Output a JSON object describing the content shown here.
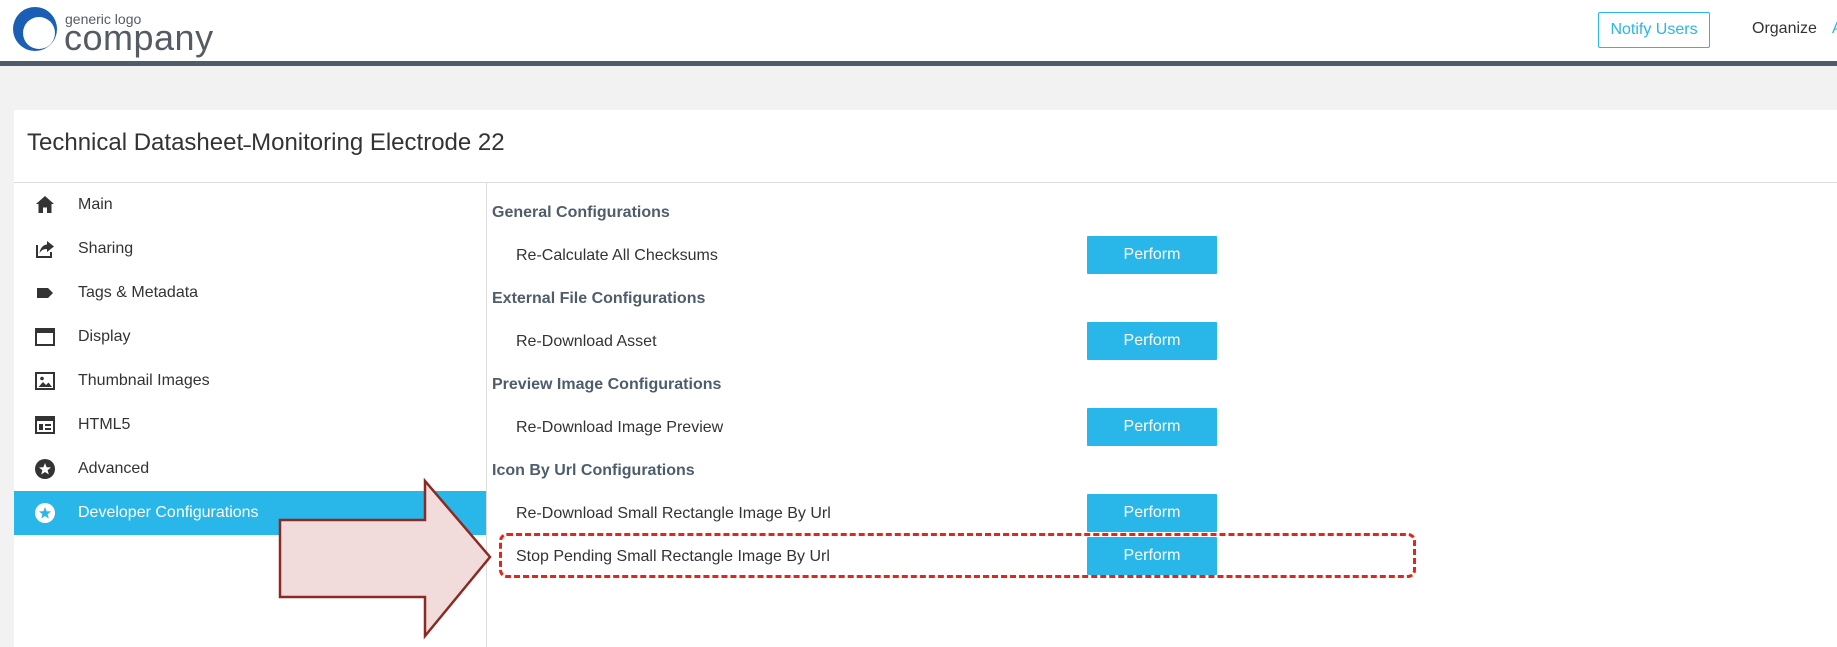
{
  "header": {
    "logo_small": "generic logo",
    "logo_big": "company",
    "notify_label": "Notify Users",
    "organize_label": "Organize",
    "cut_link_label": "A"
  },
  "panel": {
    "title": "Technical Datasheet˗Monitoring Electrode 22"
  },
  "sidebar": {
    "items": [
      {
        "label": "Main",
        "icon": "home-icon"
      },
      {
        "label": "Sharing",
        "icon": "share-icon"
      },
      {
        "label": "Tags & Metadata",
        "icon": "tag-icon"
      },
      {
        "label": "Display",
        "icon": "window-icon"
      },
      {
        "label": "Thumbnail Images",
        "icon": "image-icon"
      },
      {
        "label": "HTML5",
        "icon": "layout-icon"
      },
      {
        "label": "Advanced",
        "icon": "star-circle-icon"
      },
      {
        "label": "Developer Configurations",
        "icon": "star-circle-icon",
        "active": true
      }
    ]
  },
  "sections": [
    {
      "title": "General Configurations",
      "rows": [
        {
          "label": "Re-Calculate All Checksums",
          "button": "Perform"
        }
      ]
    },
    {
      "title": "External File Configurations",
      "rows": [
        {
          "label": "Re-Download Asset",
          "button": "Perform"
        }
      ]
    },
    {
      "title": "Preview Image Configurations",
      "rows": [
        {
          "label": "Re-Download Image Preview",
          "button": "Perform"
        }
      ]
    },
    {
      "title": "Icon By Url Configurations",
      "rows": [
        {
          "label": "Re-Download Small Rectangle Image By Url",
          "button": "Perform"
        },
        {
          "label": "Stop Pending Small Rectangle Image By Url",
          "button": "Perform",
          "highlighted": true
        }
      ]
    }
  ],
  "colors": {
    "accent": "#29b6e8",
    "header_bar": "#4e5d6c",
    "highlight_dash": "#e1261c",
    "arrow_fill": "#f2dcdb",
    "arrow_stroke": "#8b2a22"
  }
}
